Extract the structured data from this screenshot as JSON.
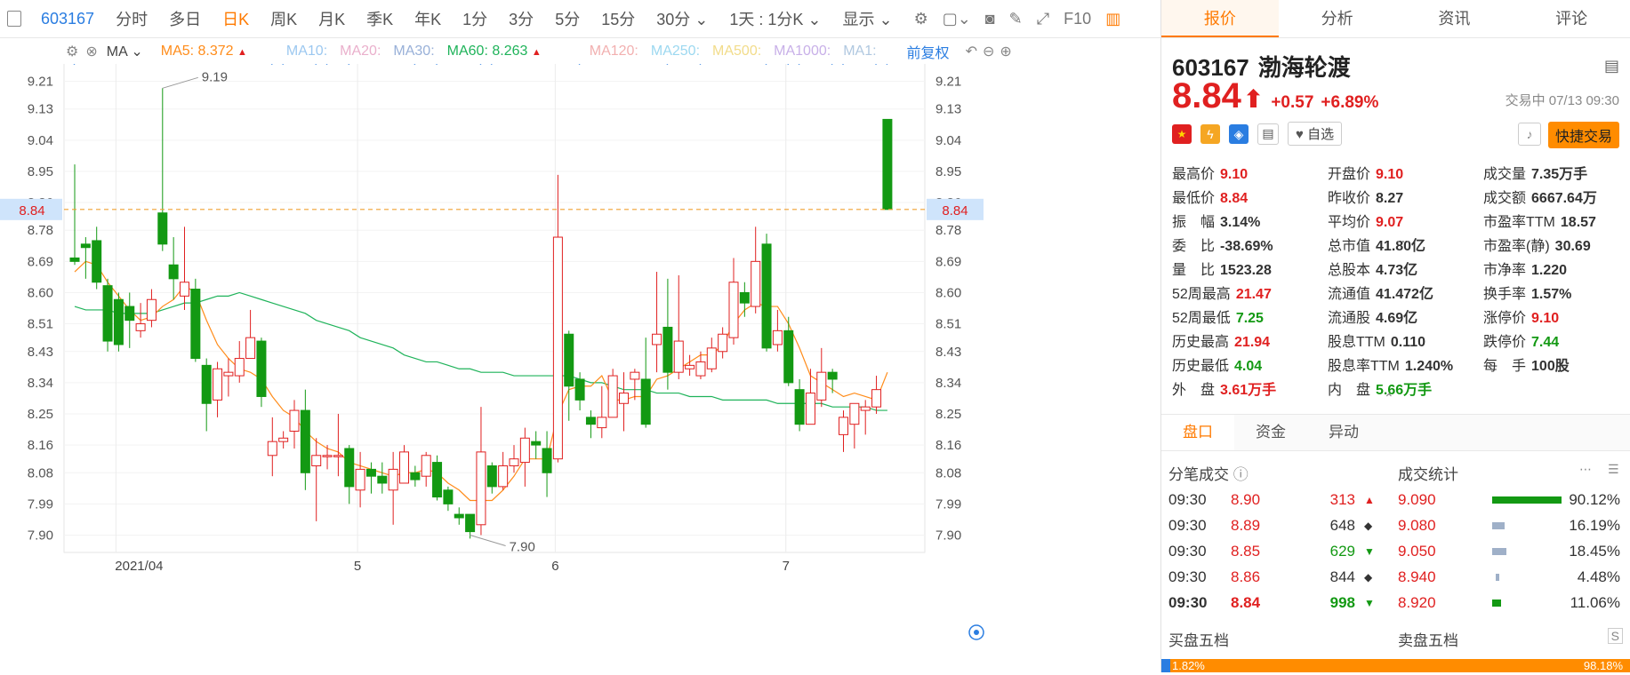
{
  "toolbar": {
    "code": "603167",
    "items": [
      "分时",
      "多日",
      "日K",
      "周K",
      "月K",
      "季K",
      "年K",
      "1分",
      "3分",
      "5分",
      "15分",
      "30分"
    ],
    "active": "日K",
    "period_select": "1天 : 1分K",
    "display": "显示",
    "f10": "F10"
  },
  "ma_bar": {
    "type": "MA",
    "ma5": "MA5: 8.372",
    "ma10": "MA10:",
    "ma20": "MA20:",
    "ma30": "MA30:",
    "ma60": "MA60: 8.263",
    "ma120": "MA120:",
    "ma250": "MA250:",
    "ma500": "MA500:",
    "ma1000": "MA1000:",
    "ma1": "MA1:",
    "adjust": "前复权",
    "colors": {
      "ma5": "#ff8c1a",
      "ma60": "#1fb35a",
      "ma10": "#7bb7ee",
      "ma20": "#e8a0c0",
      "ma30": "#88a8d8",
      "ma120": "#f0a0a0",
      "ma250": "#8ed0ee",
      "ma500": "#f0d070",
      "ma1000": "#c0a0e0"
    }
  },
  "chart_data": {
    "type": "candlestick",
    "ylim": [
      7.85,
      9.26
    ],
    "yticks": [
      "9.21",
      "9.13",
      "9.04",
      "8.95",
      "8.86",
      "8.78",
      "8.69",
      "8.60",
      "8.51",
      "8.43",
      "8.34",
      "8.25",
      "8.16",
      "8.08",
      "7.99",
      "7.90"
    ],
    "x_labels": [
      "2021/04",
      "5",
      "6",
      "7"
    ],
    "x_label_index": [
      4,
      26,
      44,
      65
    ],
    "current_price": 8.84,
    "current_price_label": "8.84",
    "high_annotation": {
      "label": "9.19",
      "index": 8,
      "value": 9.19
    },
    "low_annotation": {
      "label": "7.90",
      "index": 36,
      "value": 7.9
    },
    "candles": [
      [
        8.7,
        8.69,
        8.97,
        8.68
      ],
      [
        8.74,
        8.73,
        8.76,
        8.64
      ],
      [
        8.75,
        8.63,
        8.79,
        8.61
      ],
      [
        8.62,
        8.46,
        8.64,
        8.43
      ],
      [
        8.58,
        8.45,
        8.6,
        8.43
      ],
      [
        8.56,
        8.52,
        8.6,
        8.44
      ],
      [
        8.49,
        8.51,
        8.57,
        8.47
      ],
      [
        8.52,
        8.58,
        8.61,
        8.5
      ],
      [
        8.83,
        8.74,
        9.19,
        8.72
      ],
      [
        8.68,
        8.64,
        8.76,
        8.58
      ],
      [
        8.59,
        8.63,
        8.79,
        8.55
      ],
      [
        8.61,
        8.41,
        8.64,
        8.4
      ],
      [
        8.39,
        8.28,
        8.41,
        8.2
      ],
      [
        8.29,
        8.38,
        8.4,
        8.24
      ],
      [
        8.36,
        8.37,
        8.41,
        8.3
      ],
      [
        8.36,
        8.41,
        8.46,
        8.34
      ],
      [
        8.41,
        8.47,
        8.55,
        8.41
      ],
      [
        8.46,
        8.3,
        8.47,
        8.27
      ],
      [
        8.13,
        8.17,
        8.24,
        8.07
      ],
      [
        8.17,
        8.18,
        8.2,
        8.15
      ],
      [
        8.2,
        8.26,
        8.29,
        8.15
      ],
      [
        8.26,
        8.08,
        8.32,
        8.03
      ],
      [
        8.1,
        8.13,
        8.18,
        7.94
      ],
      [
        8.13,
        8.13,
        8.16,
        8.09
      ],
      [
        8.13,
        8.13,
        8.25,
        8.07
      ],
      [
        8.15,
        8.04,
        8.16,
        7.99
      ],
      [
        8.03,
        8.09,
        8.14,
        7.98
      ],
      [
        8.09,
        8.07,
        8.11,
        8.02
      ],
      [
        8.07,
        8.05,
        8.11,
        8.02
      ],
      [
        8.03,
        8.09,
        8.14,
        7.93
      ],
      [
        8.05,
        8.14,
        8.16,
        8.05
      ],
      [
        8.08,
        8.06,
        8.1,
        8.04
      ],
      [
        8.07,
        8.13,
        8.14,
        8.04
      ],
      [
        8.11,
        8.01,
        8.13,
        8.0
      ],
      [
        8.03,
        7.99,
        8.04,
        7.97
      ],
      [
        7.96,
        7.95,
        7.98,
        7.93
      ],
      [
        7.96,
        7.91,
        7.96,
        7.89
      ],
      [
        7.93,
        8.14,
        8.27,
        7.9
      ],
      [
        8.1,
        8.04,
        8.11,
        8.02
      ],
      [
        8.04,
        8.1,
        8.14,
        8.03
      ],
      [
        8.1,
        8.12,
        8.16,
        8.08
      ],
      [
        8.11,
        8.18,
        8.21,
        8.04
      ],
      [
        8.17,
        8.16,
        8.2,
        8.12
      ],
      [
        8.15,
        8.08,
        8.2,
        8.01
      ],
      [
        8.12,
        8.76,
        8.94,
        8.11
      ],
      [
        8.48,
        8.33,
        8.49,
        8.23
      ],
      [
        8.35,
        8.29,
        8.37,
        8.26
      ],
      [
        8.24,
        8.22,
        8.26,
        8.18
      ],
      [
        8.21,
        8.24,
        8.33,
        8.18
      ],
      [
        8.24,
        8.36,
        8.38,
        8.24
      ],
      [
        8.28,
        8.31,
        8.37,
        8.2
      ],
      [
        8.35,
        8.37,
        8.38,
        8.29
      ],
      [
        8.35,
        8.22,
        8.47,
        8.21
      ],
      [
        8.45,
        8.48,
        8.66,
        8.37
      ],
      [
        8.5,
        8.37,
        8.64,
        8.32
      ],
      [
        8.37,
        8.46,
        8.65,
        8.35
      ],
      [
        8.38,
        8.39,
        8.42,
        8.36
      ],
      [
        8.36,
        8.4,
        8.43,
        8.35
      ],
      [
        8.38,
        8.44,
        8.47,
        8.37
      ],
      [
        8.43,
        8.48,
        8.5,
        8.41
      ],
      [
        8.47,
        8.63,
        8.7,
        8.45
      ],
      [
        8.6,
        8.57,
        8.63,
        8.53
      ],
      [
        8.56,
        8.69,
        8.79,
        8.54
      ],
      [
        8.74,
        8.44,
        8.77,
        8.43
      ],
      [
        8.45,
        8.49,
        8.55,
        8.43
      ],
      [
        8.49,
        8.34,
        8.53,
        8.33
      ],
      [
        8.32,
        8.22,
        8.35,
        8.2
      ],
      [
        8.22,
        8.31,
        8.38,
        8.23
      ],
      [
        8.29,
        8.37,
        8.44,
        8.27
      ],
      [
        8.37,
        8.35,
        8.38,
        8.31
      ],
      [
        8.19,
        8.24,
        8.26,
        8.14
      ],
      [
        8.22,
        8.28,
        8.28,
        8.15
      ],
      [
        8.26,
        8.27,
        8.29,
        8.19
      ],
      [
        8.27,
        8.32,
        8.36,
        8.25
      ],
      [
        9.1,
        8.84,
        9.1,
        8.84
      ]
    ],
    "ma5": [
      8.66,
      8.69,
      8.68,
      8.63,
      8.59,
      8.55,
      8.52,
      8.53,
      8.56,
      8.58,
      8.62,
      8.6,
      8.52,
      8.45,
      8.41,
      8.38,
      8.37,
      8.35,
      8.3,
      8.26,
      8.24,
      8.2,
      8.17,
      8.15,
      8.14,
      8.11,
      8.1,
      8.09,
      8.08,
      8.07,
      8.08,
      8.08,
      8.09,
      8.08,
      8.05,
      8.03,
      8.0,
      8.0,
      8.0,
      8.03,
      8.07,
      8.12,
      8.12,
      8.12,
      8.25,
      8.32,
      8.33,
      8.33,
      8.36,
      8.29,
      8.29,
      8.3,
      8.3,
      8.35,
      8.36,
      8.38,
      8.4,
      8.42,
      8.42,
      8.45,
      8.51,
      8.55,
      8.57,
      8.56,
      8.56,
      8.51,
      8.44,
      8.36,
      8.34,
      8.32,
      8.3,
      8.31,
      8.3,
      8.29,
      8.37
    ],
    "ma60": [
      8.56,
      8.55,
      8.55,
      8.55,
      8.54,
      8.54,
      8.54,
      8.54,
      8.55,
      8.56,
      8.57,
      8.57,
      8.58,
      8.59,
      8.59,
      8.6,
      8.59,
      8.58,
      8.57,
      8.56,
      8.55,
      8.54,
      8.52,
      8.51,
      8.5,
      8.49,
      8.47,
      8.46,
      8.45,
      8.44,
      8.42,
      8.41,
      8.4,
      8.4,
      8.39,
      8.38,
      8.38,
      8.37,
      8.37,
      8.37,
      8.36,
      8.36,
      8.36,
      8.36,
      8.36,
      8.36,
      8.35,
      8.34,
      8.34,
      8.33,
      8.32,
      8.32,
      8.32,
      8.31,
      8.31,
      8.31,
      8.3,
      8.3,
      8.3,
      8.29,
      8.29,
      8.29,
      8.29,
      8.29,
      8.28,
      8.28,
      8.28,
      8.28,
      8.28,
      8.27,
      8.27,
      8.27,
      8.27,
      8.26,
      8.26
    ]
  },
  "right": {
    "tabs": [
      "报价",
      "分析",
      "资讯",
      "评论"
    ],
    "active_tab": "报价",
    "code": "603167",
    "name": "渤海轮渡",
    "price": "8.84",
    "change": "+0.57",
    "change_pct": "+6.89%",
    "trade_time": "交易中 07/13 09:30",
    "zixuan": "自选",
    "quick_trade": "快捷交易",
    "stats": [
      [
        [
          "最高价",
          "9.10",
          "up"
        ],
        [
          "开盘价",
          "9.10",
          "up"
        ],
        [
          "成交量",
          "7.35万手",
          "neu"
        ]
      ],
      [
        [
          "最低价",
          "8.84",
          "up"
        ],
        [
          "昨收价",
          "8.27",
          "neu"
        ],
        [
          "成交额",
          "6667.64万",
          "neu"
        ]
      ],
      [
        [
          "振　幅",
          "3.14%",
          "neu"
        ],
        [
          "平均价",
          "9.07",
          "up"
        ],
        [
          "市盈率TTM",
          "18.57",
          "neu"
        ]
      ],
      [
        [
          "委　比",
          "-38.69%",
          "neu"
        ],
        [
          "总市值",
          "41.80亿",
          "neu"
        ],
        [
          "市盈率(静)",
          "30.69",
          "neu"
        ]
      ],
      [
        [
          "量　比",
          "1523.28",
          "neu"
        ],
        [
          "总股本",
          "4.73亿",
          "neu"
        ],
        [
          "市净率",
          "1.220",
          "neu"
        ]
      ],
      [
        [
          "52周最高",
          "21.47",
          "up"
        ],
        [
          "流通值",
          "41.472亿",
          "neu"
        ],
        [
          "换手率",
          "1.57%",
          "neu"
        ]
      ],
      [
        [
          "52周最低",
          "7.25",
          "down"
        ],
        [
          "流通股",
          "4.69亿",
          "neu"
        ],
        [
          "涨停价",
          "9.10",
          "up"
        ]
      ],
      [
        [
          "历史最高",
          "21.94",
          "up"
        ],
        [
          "股息TTM",
          "0.110",
          "neu"
        ],
        [
          "跌停价",
          "7.44",
          "down"
        ]
      ],
      [
        [
          "历史最低",
          "4.04",
          "down"
        ],
        [
          "股息率TTM",
          "1.240%",
          "neu"
        ],
        [
          "每　手",
          "100股",
          "neu"
        ]
      ],
      [
        [
          "外　盘",
          "3.61万手",
          "up"
        ],
        [
          "内　盘",
          "5.66万手",
          "down"
        ],
        [
          "",
          "",
          " "
        ]
      ]
    ],
    "sub_tabs": [
      "盘口",
      "资金",
      "异动"
    ],
    "ticks_title": "分笔成交",
    "stats_title": "成交统计",
    "ticks": [
      [
        "09:30",
        "8.90",
        "313",
        "up"
      ],
      [
        "09:30",
        "8.89",
        "648",
        "neu"
      ],
      [
        "09:30",
        "8.85",
        "629",
        "down"
      ],
      [
        "09:30",
        "8.86",
        "844",
        "neu"
      ],
      [
        "09:30",
        "8.84",
        "998",
        "down"
      ]
    ],
    "deal_stats": [
      [
        "9.090",
        "90.12%",
        0.9012,
        "#139913"
      ],
      [
        "9.080",
        "16.19%",
        0.1619,
        "#9fb0c8"
      ],
      [
        "9.050",
        "18.45%",
        0.1845,
        "#9fb0c8"
      ],
      [
        "8.940",
        "4.48%",
        0.0448,
        "#9fb0c8"
      ],
      [
        "8.920",
        "11.06%",
        0.1106,
        "#139913"
      ]
    ],
    "buy5": "买盘五档",
    "sell5": "卖盘五档",
    "bottom_left": "1.82%",
    "bottom_right": "98.18%"
  }
}
